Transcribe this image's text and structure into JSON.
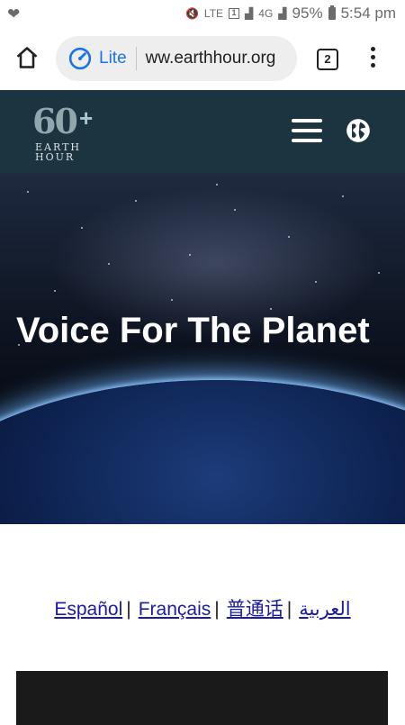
{
  "status_bar": {
    "battery": "95%",
    "time": "5:54 pm",
    "network": "4G",
    "volte": "LTE",
    "sim": "1"
  },
  "browser": {
    "mode_label": "Lite",
    "url": "ww.earthhour.org",
    "tab_count": "2"
  },
  "site": {
    "logo_number": "60",
    "logo_plus": "+",
    "logo_line1": "EARTH",
    "logo_line2": "HOUR"
  },
  "hero": {
    "title": "Voice For The Planet"
  },
  "languages": [
    {
      "label": "Español"
    },
    {
      "label": "Français"
    },
    {
      "label": "普通话"
    },
    {
      "label": "العربية"
    }
  ],
  "separator": "|",
  "colors": {
    "header_bg": "#1c3440",
    "link": "#1a1aa6",
    "lite_blue": "#1a73e8"
  }
}
